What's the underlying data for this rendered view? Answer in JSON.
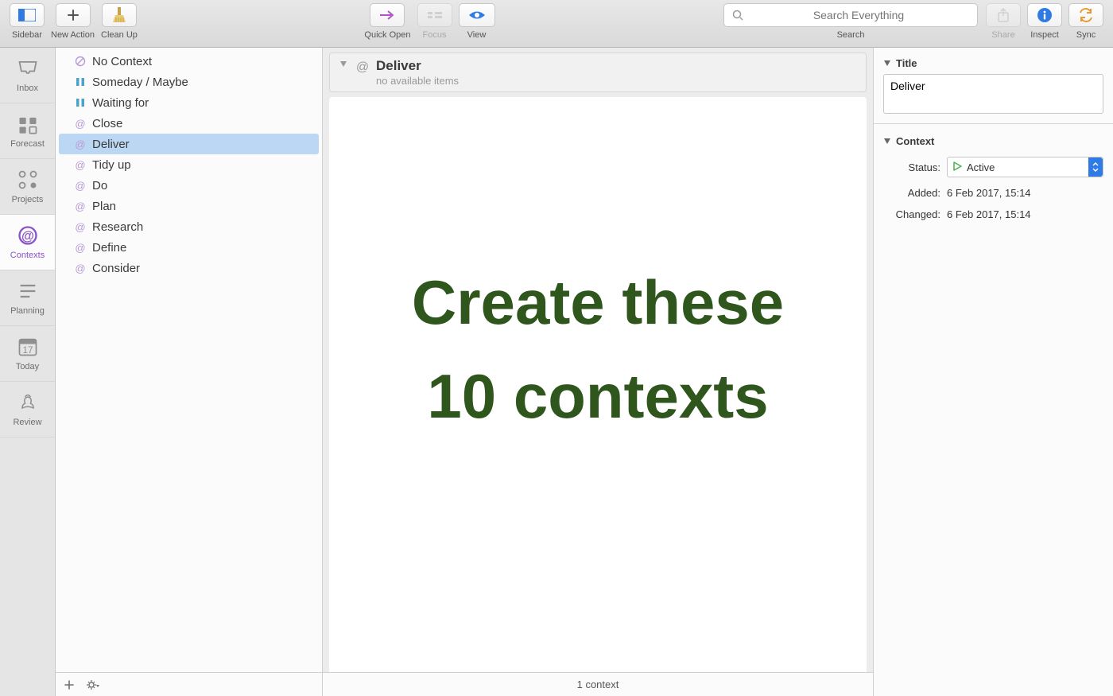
{
  "toolbar": {
    "sidebar": "Sidebar",
    "new_action": "New Action",
    "clean_up": "Clean Up",
    "quick_open": "Quick Open",
    "focus": "Focus",
    "view": "View",
    "search": "Search",
    "share": "Share",
    "inspect": "Inspect",
    "sync": "Sync",
    "search_placeholder": "Search Everything"
  },
  "perspectives": [
    {
      "id": "inbox",
      "label": "Inbox"
    },
    {
      "id": "forecast",
      "label": "Forecast"
    },
    {
      "id": "projects",
      "label": "Projects"
    },
    {
      "id": "contexts",
      "label": "Contexts"
    },
    {
      "id": "planning",
      "label": "Planning"
    },
    {
      "id": "today",
      "label": "Today"
    },
    {
      "id": "review",
      "label": "Review"
    }
  ],
  "active_perspective": "contexts",
  "today_badge": "17",
  "contexts": [
    {
      "label": "No Context",
      "type": "none"
    },
    {
      "label": "Someday / Maybe",
      "type": "paused"
    },
    {
      "label": "Waiting for",
      "type": "paused"
    },
    {
      "label": "Close",
      "type": "at"
    },
    {
      "label": "Deliver",
      "type": "at",
      "selected": true
    },
    {
      "label": "Tidy up",
      "type": "at"
    },
    {
      "label": "Do",
      "type": "at"
    },
    {
      "label": "Plan",
      "type": "at"
    },
    {
      "label": "Research",
      "type": "at"
    },
    {
      "label": "Define",
      "type": "at"
    },
    {
      "label": "Consider",
      "type": "at"
    }
  ],
  "main": {
    "title": "Deliver",
    "subtitle": "no available items",
    "status": "1 context"
  },
  "overlay": {
    "line1": "Create these",
    "line2": "10 contexts"
  },
  "inspector": {
    "title_label": "Title",
    "context_label": "Context",
    "title_value": "Deliver",
    "status_label": "Status:",
    "status_value": "Active",
    "added_label": "Added:",
    "added_value": "6 Feb 2017, 15:14",
    "changed_label": "Changed:",
    "changed_value": "6 Feb 2017, 15:14"
  }
}
